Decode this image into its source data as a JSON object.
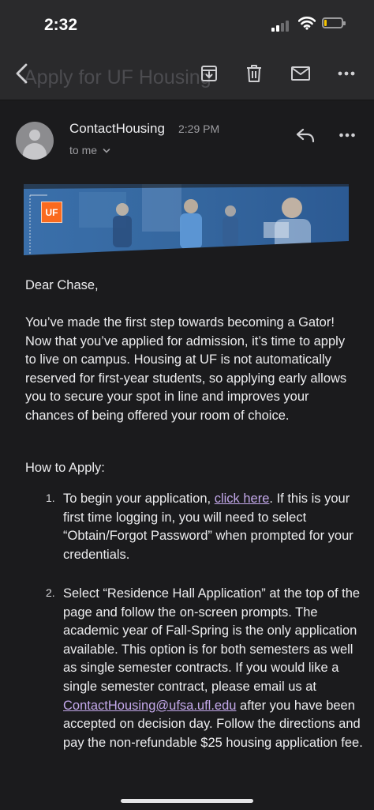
{
  "status_bar": {
    "time": "2:32",
    "battery_level": 0.15
  },
  "toolbar": {
    "title": "Apply for UF Housing",
    "back_icon": "chevron-left-icon",
    "actions": [
      "archive-icon",
      "trash-icon",
      "mail-icon",
      "more-horizontal-icon"
    ]
  },
  "email": {
    "sender": "ContactHousing",
    "time": "2:29 PM",
    "recipient": "to me",
    "banner_logo": "UF",
    "greeting": "Dear Chase,",
    "intro": "You’ve made the first step towards becoming a Gator! Now that you’ve applied for admission, it’s time to apply to live on campus. Housing at UF is not automatically reserved for first-year students, so applying early allows you to secure your spot in line and improves your chances of being offered your room of choice.",
    "how_to_apply": "How to Apply:",
    "steps": [
      {
        "number": "1.",
        "before_link": "To begin your application, ",
        "link": "click here",
        "after_link": ". If this is your first time logging in, you will need to select “Obtain/Forgot Password” when prompted for your credentials."
      },
      {
        "number": "2.",
        "before_link": "Select “Residence Hall Application” at the top of the page and follow the on-screen prompts. The academic year of Fall-Spring is the only application available. This option is for both semesters as well as single semester contracts. If you would like a single semester contract, please email us at ",
        "link": "ContactHousing@ufsa.ufl.edu",
        "after_link": " after you have been accepted on decision day. Follow the directions and pay the non-refundable $25 housing application fee."
      }
    ]
  },
  "colors": {
    "background": "#1b1b1d",
    "bar": "#2a2a2c",
    "link": "#c3a8ea",
    "uf_orange": "#fa6a1e",
    "uf_blue": "#2e63a3"
  }
}
